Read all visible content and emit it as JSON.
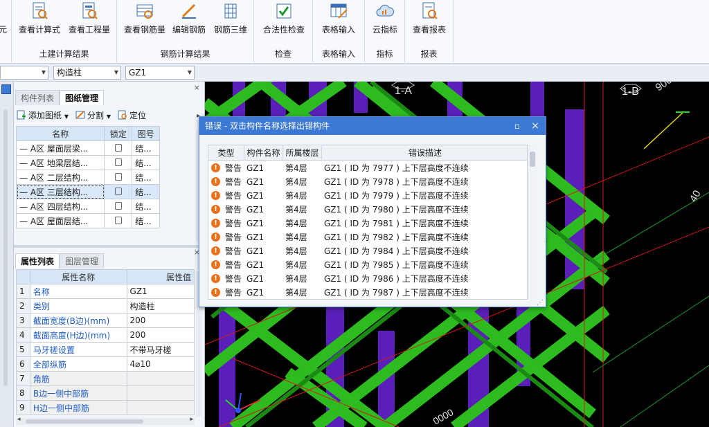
{
  "ribbon": {
    "partial_left_label": "元",
    "groups": [
      {
        "label": "土建计算结果",
        "buttons": [
          "查看计算式",
          "查看工程量"
        ]
      },
      {
        "label": "钢筋计算结果",
        "buttons": [
          "查看钢筋量",
          "编辑钢筋",
          "钢筋三维"
        ]
      },
      {
        "label": "检查",
        "buttons": [
          "合法性检查"
        ]
      },
      {
        "label": "表格输入",
        "buttons": [
          "表格输入"
        ]
      },
      {
        "label": "指标",
        "buttons": [
          "云指标"
        ]
      },
      {
        "label": "报表",
        "buttons": [
          "查看报表"
        ]
      }
    ]
  },
  "toolbar": {
    "combo1": "",
    "combo2": "构造柱",
    "combo3": "GZ1"
  },
  "component_panel": {
    "tabs": [
      "构件列表",
      "图纸管理"
    ],
    "active_tab": "图纸管理",
    "tools": [
      "添加图纸",
      "分割",
      "定位"
    ],
    "columns": [
      "名称",
      "锁定",
      "图号"
    ],
    "rows": [
      {
        "name": "A区 屋面层梁...",
        "num": "结..."
      },
      {
        "name": "A区 地梁层结...",
        "num": "结..."
      },
      {
        "name": "A区 二层结构...",
        "num": "结..."
      },
      {
        "name": "A区 三层结构...",
        "num": "结..."
      },
      {
        "name": "A区 四层结构...",
        "num": "结..."
      },
      {
        "name": "A区 屋面层结...",
        "num": "结..."
      }
    ]
  },
  "property_panel": {
    "tabs": [
      "属性列表",
      "图层管理"
    ],
    "active_tab": "属性列表",
    "columns": [
      "属性名称",
      "属性值"
    ],
    "rows": [
      {
        "idx": "1",
        "name": "名称",
        "value": "GZ1"
      },
      {
        "idx": "2",
        "name": "类别",
        "value": "构造柱"
      },
      {
        "idx": "3",
        "name": "截面宽度(B边)(mm)",
        "value": "200"
      },
      {
        "idx": "4",
        "name": "截面高度(H边)(mm)",
        "value": "200"
      },
      {
        "idx": "5",
        "name": "马牙槎设置",
        "value": "不带马牙槎"
      },
      {
        "idx": "6",
        "name": "全部纵筋",
        "value": "4⌀10"
      },
      {
        "idx": "7",
        "name": "角筋",
        "value": ""
      },
      {
        "idx": "8",
        "name": "B边一侧中部筋",
        "value": ""
      },
      {
        "idx": "9",
        "name": "H边一侧中部筋",
        "value": ""
      }
    ]
  },
  "canvas": {
    "labels": [
      "1-A",
      "1-B"
    ],
    "numbers": [
      "40",
      "900",
      "0000"
    ]
  },
  "dialog": {
    "title": "错误 - 双击构件名称选择出错构件",
    "columns": [
      "类型",
      "构件名称",
      "所属楼层",
      "错误描述"
    ],
    "rows": [
      {
        "type": "警告",
        "name": "GZ1",
        "floor": "第4层",
        "desc": "GZ1 ( ID 为 7977 ) 上下层高度不连续"
      },
      {
        "type": "警告",
        "name": "GZ1",
        "floor": "第4层",
        "desc": "GZ1 ( ID 为 7978 ) 上下层高度不连续"
      },
      {
        "type": "警告",
        "name": "GZ1",
        "floor": "第4层",
        "desc": "GZ1 ( ID 为 7979 ) 上下层高度不连续"
      },
      {
        "type": "警告",
        "name": "GZ1",
        "floor": "第4层",
        "desc": "GZ1 ( ID 为 7980 ) 上下层高度不连续"
      },
      {
        "type": "警告",
        "name": "GZ1",
        "floor": "第4层",
        "desc": "GZ1 ( ID 为 7981 ) 上下层高度不连续"
      },
      {
        "type": "警告",
        "name": "GZ1",
        "floor": "第4层",
        "desc": "GZ1 ( ID 为 7982 ) 上下层高度不连续"
      },
      {
        "type": "警告",
        "name": "GZ1",
        "floor": "第4层",
        "desc": "GZ1 ( ID 为 7984 ) 上下层高度不连续"
      },
      {
        "type": "警告",
        "name": "GZ1",
        "floor": "第4层",
        "desc": "GZ1 ( ID 为 7985 ) 上下层高度不连续"
      },
      {
        "type": "警告",
        "name": "GZ1",
        "floor": "第4层",
        "desc": "GZ1 ( ID 为 7986 ) 上下层高度不连续"
      },
      {
        "type": "警告",
        "name": "GZ1",
        "floor": "第4层",
        "desc": "GZ1 ( ID 为 7987 ) 上下层高度不连续"
      }
    ]
  },
  "colors": {
    "rebar_green": "#2dbb1f",
    "column_purple": "#5a1fb8",
    "dialog_title": "#3b79d5",
    "warning_orange": "#e8711a"
  }
}
